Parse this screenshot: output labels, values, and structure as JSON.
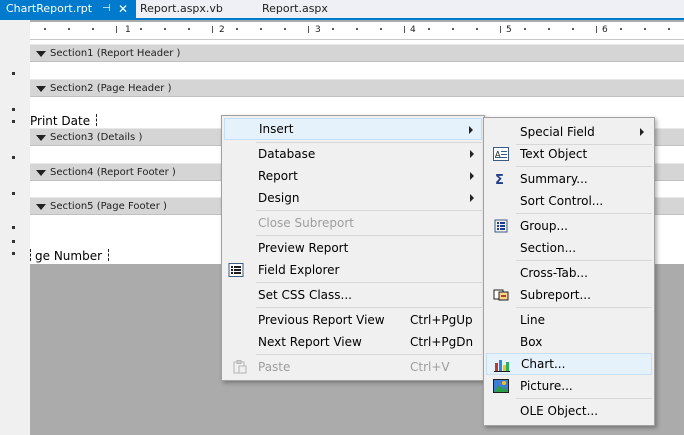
{
  "tabs": [
    {
      "label": "ChartReport.rpt",
      "active": true
    },
    {
      "label": "Report.aspx.vb",
      "active": false
    },
    {
      "label": "Report.aspx",
      "active": false
    }
  ],
  "ruler": [
    "1",
    "2",
    "3",
    "4",
    "5",
    "6"
  ],
  "sections": [
    "Section1 (Report Header  )",
    "Section2 (Page Header  )",
    "Section3 (Details  )",
    "Section4 (Report Footer  )",
    "Section5 (Page Footer  )"
  ],
  "fields": {
    "print_date": "Print Date",
    "page_number": "ge Number"
  },
  "context_menu": {
    "insert": "Insert",
    "database": "Database",
    "report": "Report",
    "design": "Design",
    "close_subreport": "Close Subreport",
    "preview_report": "Preview Report",
    "field_explorer": "Field Explorer",
    "set_css_class": "Set CSS Class...",
    "previous_report_view": "Previous Report View",
    "previous_shortcut": "Ctrl+PgUp",
    "next_report_view": "Next Report View",
    "next_shortcut": "Ctrl+PgDn",
    "paste": "Paste",
    "paste_shortcut": "Ctrl+V"
  },
  "insert_submenu": {
    "special_field": "Special Field",
    "text_object": "Text Object",
    "summary": "Summary...",
    "sort_control": "Sort Control...",
    "group": "Group...",
    "section": "Section...",
    "cross_tab": "Cross-Tab...",
    "subreport": "Subreport...",
    "line": "Line",
    "box": "Box",
    "chart": "Chart...",
    "picture": "Picture...",
    "ole_object": "OLE Object..."
  },
  "colors": {
    "accent": "#007acc",
    "highlight": "#e5f1fb",
    "section_bar": "#d5d5d5"
  }
}
